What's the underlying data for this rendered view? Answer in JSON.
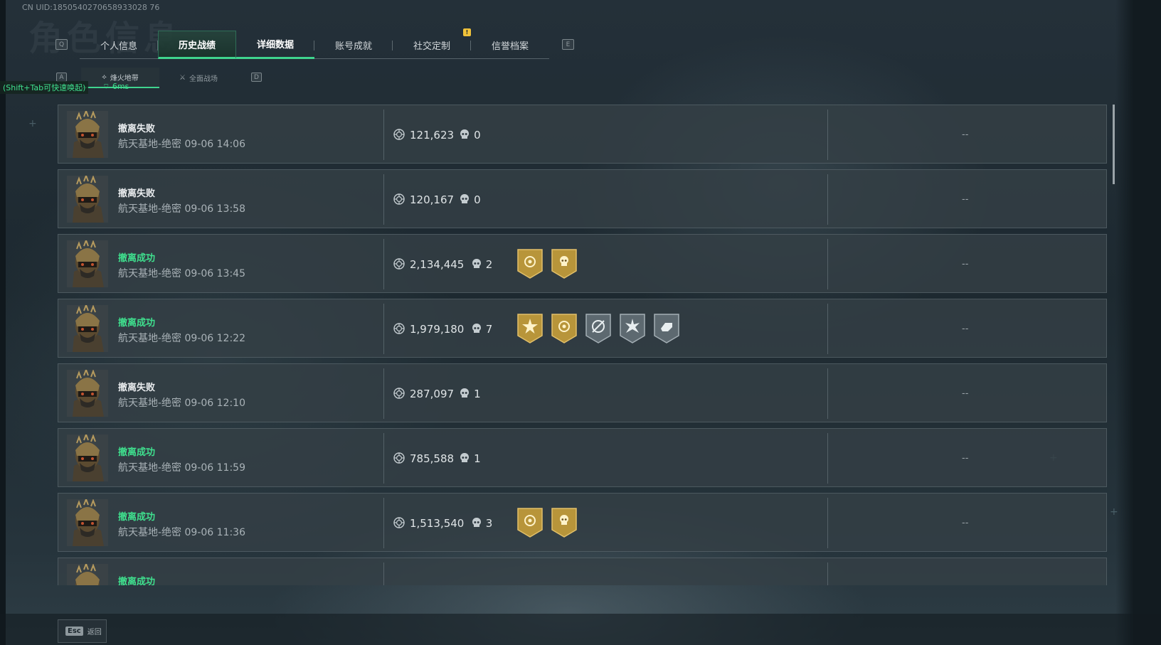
{
  "uid": "CN UID:1850540270658933028 76",
  "tabs": [
    {
      "label": "个人信息"
    },
    {
      "label": "历史战绩"
    },
    {
      "label": "详细数据"
    },
    {
      "label": "账号成就"
    },
    {
      "label": "社交定制"
    },
    {
      "label": "信誉档案"
    }
  ],
  "keys": {
    "left": "Q",
    "right": "E",
    "sub_left": "A",
    "sub_right": "D",
    "esc": "Esc"
  },
  "subtabs": [
    {
      "label": "烽火地带"
    },
    {
      "label": "全面战场"
    }
  ],
  "hint": "(Shift+Tab可快速唤起)",
  "ping": "6ms",
  "matches": [
    {
      "status": "撤离失败",
      "result": "fail",
      "map": "航天基地-绝密",
      "time": "09-06 14:06",
      "value": "121,623",
      "kills": "0",
      "medals": [],
      "extra": "--"
    },
    {
      "status": "撤离失败",
      "result": "fail",
      "map": "航天基地-绝密",
      "time": "09-06 13:58",
      "value": "120,167",
      "kills": "0",
      "medals": [],
      "extra": "--"
    },
    {
      "status": "撤离成功",
      "result": "success",
      "map": "航天基地-绝密",
      "time": "09-06 13:45",
      "value": "2,134,445",
      "kills": "2",
      "medals": [
        "gold-coin-medal-icon",
        "gold-skull-medal-icon"
      ],
      "extra": "--"
    },
    {
      "status": "撤离成功",
      "result": "success",
      "map": "航天基地-绝密",
      "time": "09-06 12:22",
      "value": "1,979,180",
      "kills": "7",
      "medals": [
        "gold-sun-medal-icon",
        "gold-coin-medal-icon",
        "silver-crosshair-medal-icon",
        "silver-star-medal-icon",
        "silver-hand-medal-icon"
      ],
      "extra": "--"
    },
    {
      "status": "撤离失败",
      "result": "fail",
      "map": "航天基地-绝密",
      "time": "09-06 12:10",
      "value": "287,097",
      "kills": "1",
      "medals": [],
      "extra": "--"
    },
    {
      "status": "撤离成功",
      "result": "success",
      "map": "航天基地-绝密",
      "time": "09-06 11:59",
      "value": "785,588",
      "kills": "1",
      "medals": [],
      "extra": "--"
    },
    {
      "status": "撤离成功",
      "result": "success",
      "map": "航天基地-绝密",
      "time": "09-06 11:36",
      "value": "1,513,540",
      "kills": "3",
      "medals": [
        "gold-coin-medal-icon",
        "gold-skull-medal-icon"
      ],
      "extra": "--"
    },
    {
      "status": "撤离成功",
      "result": "success",
      "map": "",
      "time": "",
      "value": "",
      "kills": "",
      "medals": [],
      "extra": ""
    }
  ],
  "footer": {
    "back_label": "返回"
  },
  "colors": {
    "success": "#3fe08e",
    "accent": "#3fd48e",
    "gold": "#b8953a",
    "silver": "#5d6970"
  }
}
